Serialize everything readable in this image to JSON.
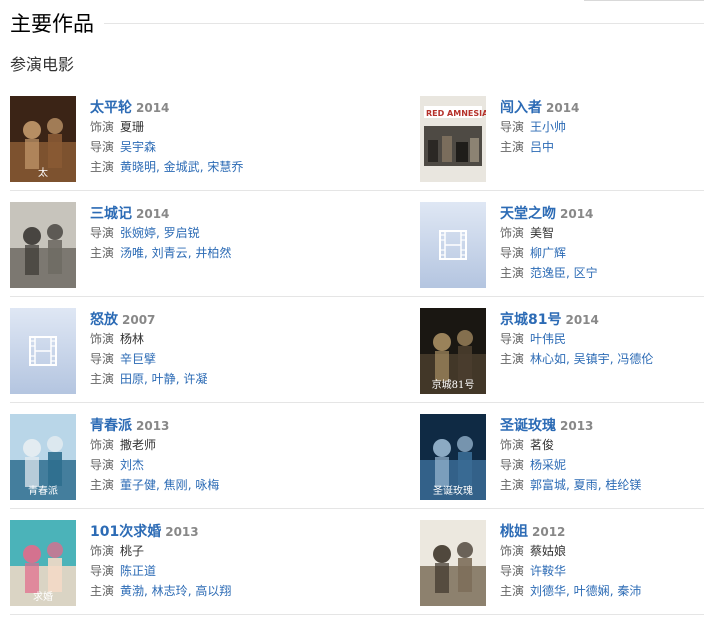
{
  "header": {
    "section_title": "主要作品",
    "subsection_title": "参演电影"
  },
  "labels": {
    "played": "饰演",
    "director": "导演",
    "starring": "主演"
  },
  "icons": {
    "placeholder": "film-strip-icon"
  },
  "colors": {
    "link": "#2c6bb5",
    "year": "#888888",
    "placeholder_bg": "#c9d6ea"
  },
  "movies": [
    {
      "title": "太平轮",
      "year": "2014",
      "role": "夏珊",
      "directors": [
        "吴宇森"
      ],
      "stars": [
        "黄晓明",
        "金城武",
        "宋慧乔"
      ],
      "poster": "poster-taipinglun",
      "poster_text": "太"
    },
    {
      "title": "闯入者",
      "year": "2014",
      "role": null,
      "directors": [
        "王小帅"
      ],
      "stars": [
        "吕中"
      ],
      "poster": "poster-red-amnesia",
      "poster_text": "RED AMNESIA"
    },
    {
      "title": "三城记",
      "year": "2014",
      "role": null,
      "directors": [
        "张婉婷",
        "罗启锐"
      ],
      "stars": [
        "汤唯",
        "刘青云",
        "井柏然"
      ],
      "poster": "poster-sanchengji",
      "poster_text": ""
    },
    {
      "title": "天堂之吻",
      "year": "2014",
      "role": "美智",
      "directors": [
        "柳广辉"
      ],
      "stars": [
        "范逸臣",
        "区宁"
      ],
      "poster": "placeholder",
      "poster_text": ""
    },
    {
      "title": "怒放",
      "year": "2007",
      "role": "杨林",
      "directors": [
        "辛巨擘"
      ],
      "stars": [
        "田原",
        "叶静",
        "许凝"
      ],
      "poster": "placeholder",
      "poster_text": ""
    },
    {
      "title": "京城81号",
      "year": "2014",
      "role": null,
      "directors": [
        "叶伟民"
      ],
      "stars": [
        "林心如",
        "吴镇宇",
        "冯德伦"
      ],
      "poster": "poster-jingcheng",
      "poster_text": "京城81号"
    },
    {
      "title": "青春派",
      "year": "2013",
      "role": "撒老师",
      "directors": [
        "刘杰"
      ],
      "stars": [
        "董子健",
        "焦刚",
        "咏梅"
      ],
      "poster": "poster-qingchunpai",
      "poster_text": "青春派"
    },
    {
      "title": "圣诞玫瑰",
      "year": "2013",
      "role": "茗俊",
      "directors": [
        "杨采妮"
      ],
      "stars": [
        "郭富城",
        "夏雨",
        "桂纶镁"
      ],
      "poster": "poster-shengdan",
      "poster_text": "圣诞玫瑰"
    },
    {
      "title": "101次求婚",
      "year": "2013",
      "role": "桃子",
      "directors": [
        "陈正道"
      ],
      "stars": [
        "黄渤",
        "林志玲",
        "高以翔"
      ],
      "poster": "poster-101",
      "poster_text": "求婚"
    },
    {
      "title": "桃姐",
      "year": "2012",
      "role": "蔡姑娘",
      "directors": [
        "许鞍华"
      ],
      "stars": [
        "刘德华",
        "叶德娴",
        "秦沛"
      ],
      "poster": "poster-taojie",
      "poster_text": ""
    }
  ]
}
